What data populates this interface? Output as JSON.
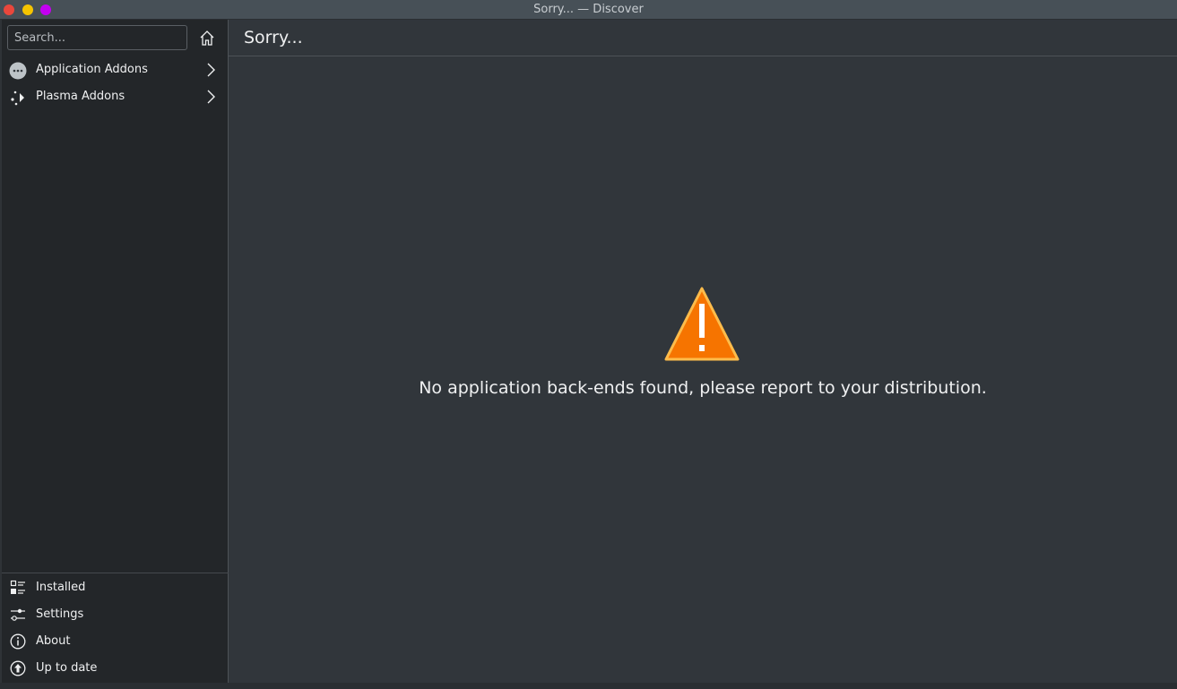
{
  "window": {
    "title": "Sorry... — Discover"
  },
  "sidebar": {
    "search": {
      "placeholder": "Search...",
      "value": ""
    },
    "categories": [
      {
        "label": "Application Addons",
        "icon": "addons-icon"
      },
      {
        "label": "Plasma Addons",
        "icon": "plasma-icon"
      }
    ],
    "bottom": [
      {
        "label": "Installed",
        "icon": "installed-icon"
      },
      {
        "label": "Settings",
        "icon": "settings-icon"
      },
      {
        "label": "About",
        "icon": "info-icon"
      },
      {
        "label": "Up to date",
        "icon": "update-icon"
      }
    ]
  },
  "main": {
    "page_title": "Sorry...",
    "message": "No application back-ends found, please report to your distribution."
  },
  "colors": {
    "warning": "#f67400",
    "background": "#31363b",
    "sidebar": "#232629"
  }
}
